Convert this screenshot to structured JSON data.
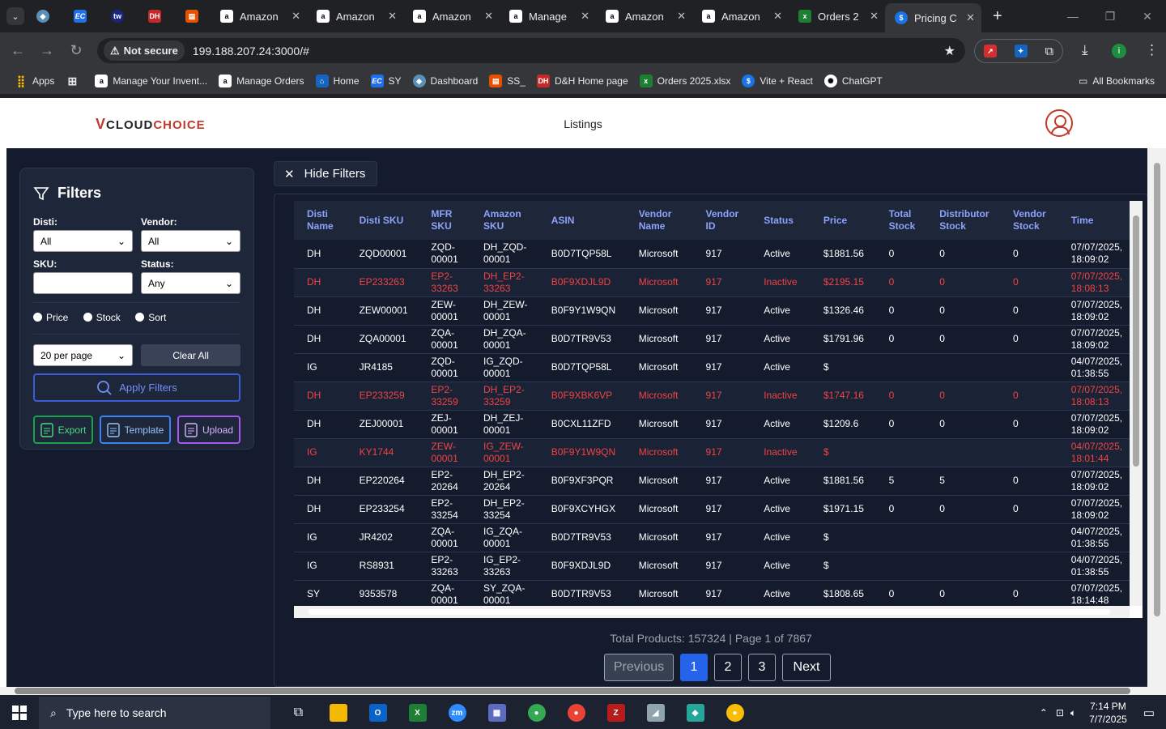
{
  "browser": {
    "tabs": [
      {
        "title": "Amazon",
        "icon": "amazon-icon"
      },
      {
        "title": "Amazon",
        "icon": "amazon-icon"
      },
      {
        "title": "Amazon",
        "icon": "amazon-icon"
      },
      {
        "title": "Manage",
        "icon": "amazon-icon"
      },
      {
        "title": "Amazon",
        "icon": "amazon-icon"
      },
      {
        "title": "Amazon",
        "icon": "amazon-icon"
      },
      {
        "title": "Orders 2",
        "icon": "excel-icon"
      },
      {
        "title": "Pricing C",
        "icon": "dollar-icon"
      }
    ],
    "security_label": "Not secure",
    "url": "199.188.207.24:3000/#",
    "bookmarks": [
      {
        "label": "Apps"
      },
      {
        "label": "Manage Your Invent..."
      },
      {
        "label": "Manage Orders"
      },
      {
        "label": "Home"
      },
      {
        "label": "SY"
      },
      {
        "label": "Dashboard"
      },
      {
        "label": "SS_"
      },
      {
        "label": "D&H Home page"
      },
      {
        "label": "Orders 2025.xlsx"
      },
      {
        "label": "Vite + React"
      },
      {
        "label": "ChatGPT"
      }
    ],
    "all_bookmarks": "All Bookmarks"
  },
  "app": {
    "logo": {
      "v": "V",
      "cloud": "CLOUD",
      "choice": "CHOICE"
    },
    "page_title": "Listings",
    "hide_filters": "Hide Filters",
    "filters": {
      "title": "Filters",
      "disti_label": "Disti:",
      "disti_value": "All",
      "vendor_label": "Vendor:",
      "vendor_value": "All",
      "sku_label": "SKU:",
      "sku_value": "",
      "status_label": "Status:",
      "status_value": "Any",
      "radio_price": "Price",
      "radio_stock": "Stock",
      "radio_sort": "Sort",
      "per_page": "20 per page",
      "clear_all": "Clear All",
      "apply": "Apply Filters",
      "export": "Export",
      "template": "Template",
      "upload": "Upload"
    },
    "table": {
      "columns": [
        "Disti Name",
        "Disti SKU",
        "MFR SKU",
        "Amazon SKU",
        "ASIN",
        "Vendor Name",
        "Vendor ID",
        "Status",
        "Price",
        "Total Stock",
        "Distributor Stock",
        "Vendor Stock",
        "Time"
      ],
      "rows": [
        {
          "status_type": "active",
          "cells": [
            "DH",
            "ZQD00001",
            "ZQD-00001",
            "DH_ZQD-00001",
            "B0D7TQP58L",
            "Microsoft",
            "917",
            "Active",
            "$1881.56",
            "0",
            "0",
            "0",
            "07/07/2025, 18:09:02"
          ]
        },
        {
          "status_type": "inactive",
          "cells": [
            "DH",
            "EP233263",
            "EP2-33263",
            "DH_EP2-33263",
            "B0F9XDJL9D",
            "Microsoft",
            "917",
            "Inactive",
            "$2195.15",
            "0",
            "0",
            "0",
            "07/07/2025, 18:08:13"
          ]
        },
        {
          "status_type": "active",
          "cells": [
            "DH",
            "ZEW00001",
            "ZEW-00001",
            "DH_ZEW-00001",
            "B0F9Y1W9QN",
            "Microsoft",
            "917",
            "Active",
            "$1326.46",
            "0",
            "0",
            "0",
            "07/07/2025, 18:09:02"
          ]
        },
        {
          "status_type": "active",
          "cells": [
            "DH",
            "ZQA00001",
            "ZQA-00001",
            "DH_ZQA-00001",
            "B0D7TR9V53",
            "Microsoft",
            "917",
            "Active",
            "$1791.96",
            "0",
            "0",
            "0",
            "07/07/2025, 18:09:02"
          ]
        },
        {
          "status_type": "active",
          "cells": [
            "IG",
            "JR4185",
            "ZQD-00001",
            "IG_ZQD-00001",
            "B0D7TQP58L",
            "Microsoft",
            "917",
            "Active",
            "$",
            "",
            "",
            "",
            "04/07/2025, 01:38:55"
          ]
        },
        {
          "status_type": "inactive",
          "cells": [
            "DH",
            "EP233259",
            "EP2-33259",
            "DH_EP2-33259",
            "B0F9XBK6VP",
            "Microsoft",
            "917",
            "Inactive",
            "$1747.16",
            "0",
            "0",
            "0",
            "07/07/2025, 18:08:13"
          ]
        },
        {
          "status_type": "active",
          "cells": [
            "DH",
            "ZEJ00001",
            "ZEJ-00001",
            "DH_ZEJ-00001",
            "B0CXL11ZFD",
            "Microsoft",
            "917",
            "Active",
            "$1209.6",
            "0",
            "0",
            "0",
            "07/07/2025, 18:09:02"
          ]
        },
        {
          "status_type": "inactive",
          "cells": [
            "IG",
            "KY1744",
            "ZEW-00001",
            "IG_ZEW-00001",
            "B0F9Y1W9QN",
            "Microsoft",
            "917",
            "Inactive",
            "$",
            "",
            "",
            "",
            "04/07/2025, 18:01:44"
          ]
        },
        {
          "status_type": "active",
          "cells": [
            "DH",
            "EP220264",
            "EP2-20264",
            "DH_EP2-20264",
            "B0F9XF3PQR",
            "Microsoft",
            "917",
            "Active",
            "$1881.56",
            "5",
            "5",
            "0",
            "07/07/2025, 18:09:02"
          ]
        },
        {
          "status_type": "active",
          "cells": [
            "DH",
            "EP233254",
            "EP2-33254",
            "DH_EP2-33254",
            "B0F9XCYHGX",
            "Microsoft",
            "917",
            "Active",
            "$1971.15",
            "0",
            "0",
            "0",
            "07/07/2025, 18:09:02"
          ]
        },
        {
          "status_type": "active",
          "cells": [
            "IG",
            "JR4202",
            "ZQA-00001",
            "IG_ZQA-00001",
            "B0D7TR9V53",
            "Microsoft",
            "917",
            "Active",
            "$",
            "",
            "",
            "",
            "04/07/2025, 01:38:55"
          ]
        },
        {
          "status_type": "active",
          "cells": [
            "IG",
            "RS8931",
            "EP2-33263",
            "IG_EP2-33263",
            "B0F9XDJL9D",
            "Microsoft",
            "917",
            "Active",
            "$",
            "",
            "",
            "",
            "04/07/2025, 01:38:55"
          ]
        },
        {
          "status_type": "active",
          "cells": [
            "SY",
            "9353578",
            "ZQA-00001",
            "SY_ZQA-00001",
            "B0D7TR9V53",
            "Microsoft",
            "917",
            "Active",
            "$1808.65",
            "0",
            "0",
            "0",
            "07/07/2025, 18:14:48"
          ]
        }
      ]
    },
    "pagination": {
      "info": "Total Products: 157324 | Page 1 of 7867",
      "previous": "Previous",
      "pages": [
        "1",
        "2",
        "3"
      ],
      "next": "Next"
    }
  },
  "taskbar": {
    "search_placeholder": "Type here to search",
    "time": "7:14 PM",
    "date": "7/7/2025"
  },
  "colors": {
    "accent": "#2563eb",
    "inactive": "#ef4444",
    "header_text": "#8da2fb",
    "panel_bg": "#141b2d"
  }
}
